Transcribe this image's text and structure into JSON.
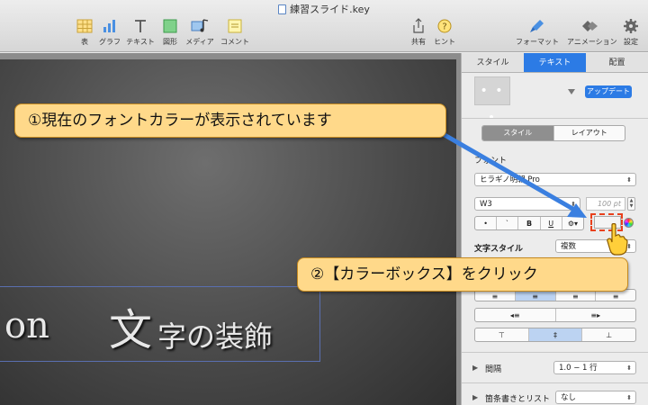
{
  "window": {
    "title": "練習スライド.key"
  },
  "toolbar": {
    "left_buttons": [
      {
        "label": "表",
        "icon": "table-icon"
      },
      {
        "label": "グラフ",
        "icon": "chart-icon"
      },
      {
        "label": "テキスト",
        "icon": "text-icon"
      },
      {
        "label": "図形",
        "icon": "shape-icon"
      },
      {
        "label": "メディア",
        "icon": "media-icon"
      },
      {
        "label": "コメント",
        "icon": "comment-icon"
      }
    ],
    "right_buttons": [
      {
        "label": "共有",
        "icon": "share-icon"
      },
      {
        "label": "ヒント",
        "icon": "help-icon"
      },
      {
        "label": "フォーマット",
        "icon": "format-brush-icon"
      },
      {
        "label": "アニメーション",
        "icon": "animation-icon"
      },
      {
        "label": "設定",
        "icon": "gear-icon"
      }
    ]
  },
  "slide": {
    "text_part1": "on",
    "text_part2": "文",
    "text_part3": "字の装飾"
  },
  "inspector": {
    "tabs": [
      "スタイル",
      "テキスト",
      "配置"
    ],
    "active_tab": "テキスト",
    "preview_dots": "• • •",
    "update_button": "アップデート",
    "subtabs": [
      "スタイル",
      "レイアウト"
    ],
    "font_section_label": "フォント",
    "font_family": "ヒラギノ明朝 Pro",
    "font_weight": "W3",
    "font_size": "100 pt",
    "format_buttons": [
      "•",
      "ˋ",
      "B",
      "U",
      "⚙▾"
    ],
    "char_style_label": "文字スタイル",
    "char_style_value": "複数",
    "align_icons": [
      "align-left-icon",
      "align-center-icon",
      "align-right-icon",
      "justify-icon"
    ],
    "indent_icons": [
      "outdent-icon",
      "indent-icon"
    ],
    "valign_icons": [
      "valign-top-icon",
      "valign-middle-icon",
      "valign-bottom-icon"
    ],
    "spacing_label": "間隔",
    "spacing_value": "1.0 − 1 行",
    "bullets_label": "箇条書きとリスト",
    "bullets_value": "なし",
    "colors": {
      "accent": "#2c7be5"
    }
  },
  "callouts": {
    "first": "①現在のフォントカラーが表示されています",
    "second": "②【カラーボックス】をクリック",
    "callout_fill": "#ffd98a",
    "arrow_color": "#3a7fe0",
    "highlight_color": "#e8401c"
  }
}
